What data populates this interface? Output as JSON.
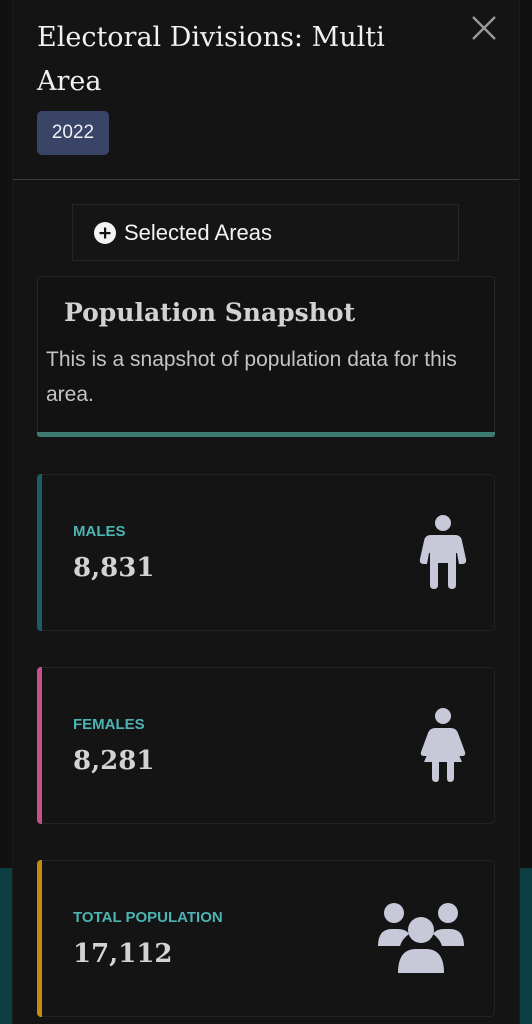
{
  "dialog": {
    "title": "Electoral Divisions: Multi Area",
    "year_badge": "2022",
    "close_icon": "close-icon"
  },
  "selected_areas": {
    "label": "Selected Areas",
    "icon": "plus-circle-icon"
  },
  "snapshot": {
    "title": "Population Snapshot",
    "description": "This is a snapshot of population data for this area.",
    "accent_color": "#3d7b72"
  },
  "stats": [
    {
      "label": "MALES",
      "value": "8,831",
      "icon": "male-icon",
      "accent_color": "#1b5e66"
    },
    {
      "label": "FEMALES",
      "value": "8,281",
      "icon": "female-icon",
      "accent_color": "#c4508c"
    },
    {
      "label": "TOTAL POPULATION",
      "value": "17,112",
      "icon": "users-icon",
      "accent_color": "#c58a12"
    }
  ],
  "colors": {
    "label_teal": "#4db4b4",
    "icon_color": "#c7c9d8",
    "badge_bg": "#3a4466"
  }
}
